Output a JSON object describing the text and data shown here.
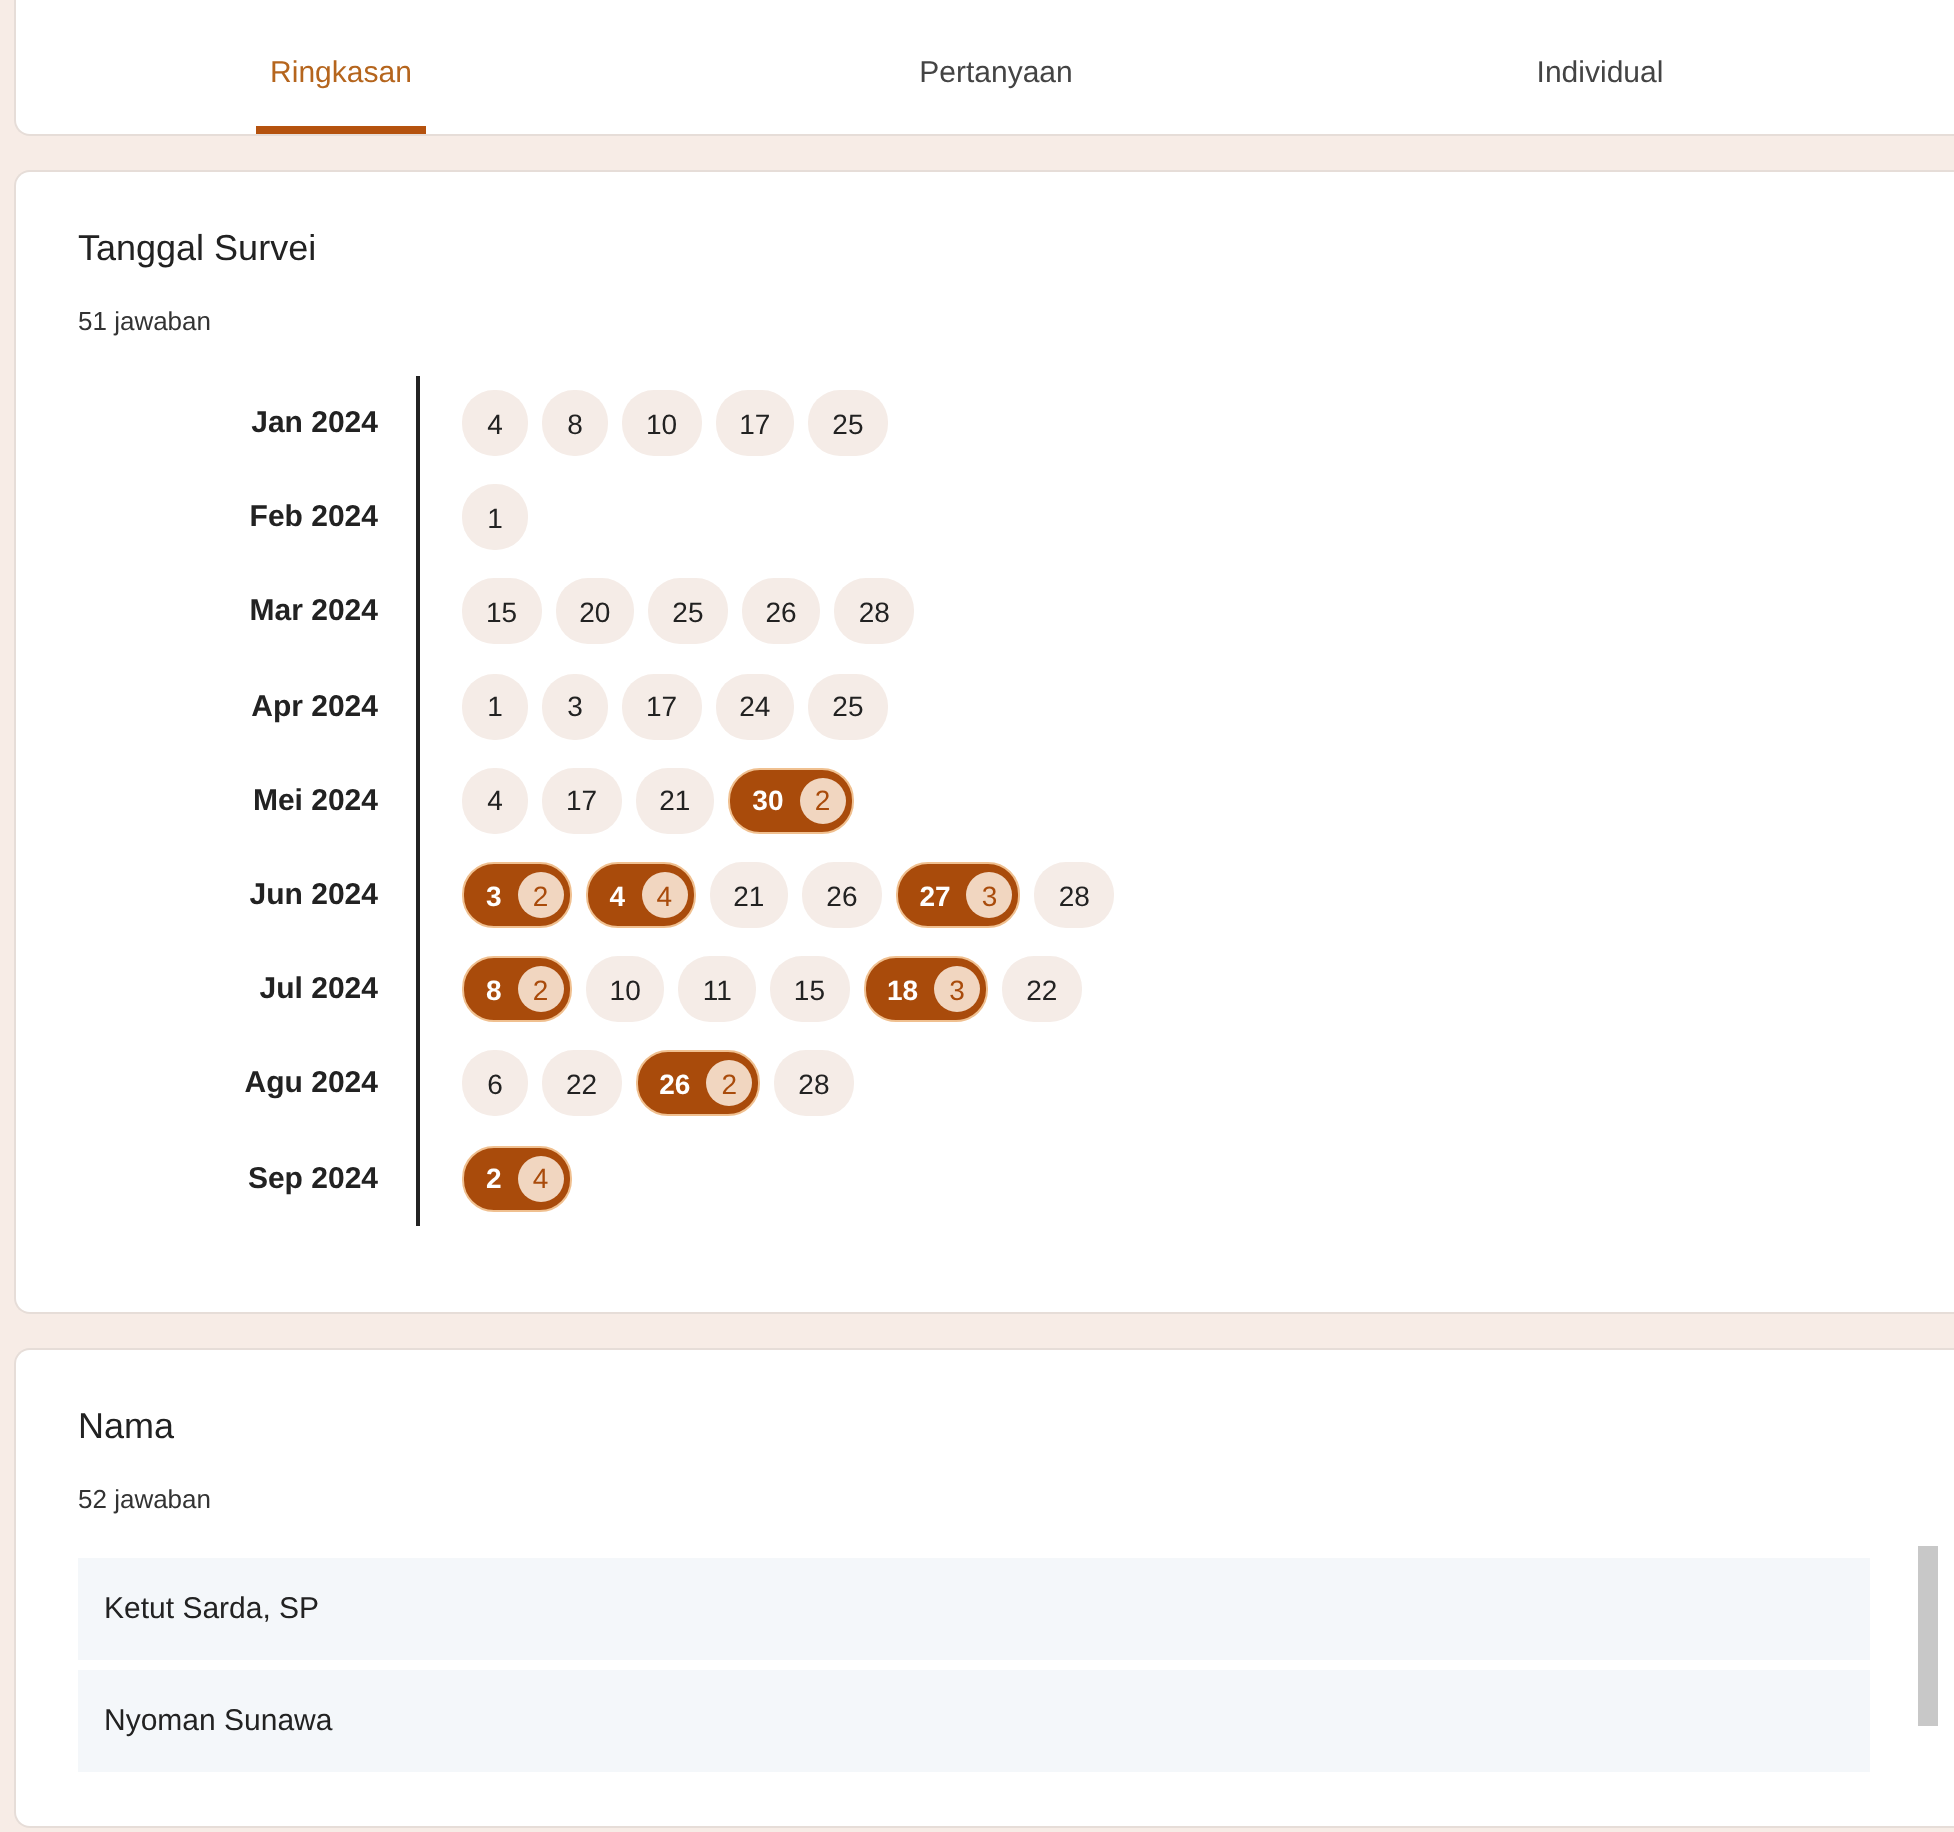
{
  "tabs": [
    {
      "label": "Ringkasan",
      "selected": true
    },
    {
      "label": "Pertanyaan",
      "selected": false
    },
    {
      "label": "Individual",
      "selected": false
    }
  ],
  "date_question": {
    "title": "Tanggal Survei",
    "responses": "51 jawaban",
    "months": [
      {
        "label": "Jan 2024",
        "days": [
          {
            "day": "4"
          },
          {
            "day": "8"
          },
          {
            "day": "10"
          },
          {
            "day": "17"
          },
          {
            "day": "25"
          }
        ]
      },
      {
        "label": "Feb 2024",
        "days": [
          {
            "day": "1"
          }
        ]
      },
      {
        "label": "Mar 2024",
        "days": [
          {
            "day": "15"
          },
          {
            "day": "20"
          },
          {
            "day": "25"
          },
          {
            "day": "26"
          },
          {
            "day": "28"
          }
        ]
      },
      {
        "label": "Apr 2024",
        "days": [
          {
            "day": "1"
          },
          {
            "day": "3"
          },
          {
            "day": "17"
          },
          {
            "day": "24"
          },
          {
            "day": "25"
          }
        ]
      },
      {
        "label": "Mei 2024",
        "days": [
          {
            "day": "4"
          },
          {
            "day": "17"
          },
          {
            "day": "21"
          },
          {
            "day": "30",
            "count": "2"
          }
        ]
      },
      {
        "label": "Jun 2024",
        "days": [
          {
            "day": "3",
            "count": "2"
          },
          {
            "day": "4",
            "count": "4"
          },
          {
            "day": "21"
          },
          {
            "day": "26"
          },
          {
            "day": "27",
            "count": "3"
          },
          {
            "day": "28"
          }
        ]
      },
      {
        "label": "Jul 2024",
        "days": [
          {
            "day": "8",
            "count": "2"
          },
          {
            "day": "10"
          },
          {
            "day": "11"
          },
          {
            "day": "15"
          },
          {
            "day": "18",
            "count": "3"
          },
          {
            "day": "22"
          }
        ]
      },
      {
        "label": "Agu 2024",
        "days": [
          {
            "day": "6"
          },
          {
            "day": "22"
          },
          {
            "day": "26",
            "count": "2"
          },
          {
            "day": "28"
          }
        ]
      },
      {
        "label": "Sep 2024",
        "days": [
          {
            "day": "2",
            "count": "4"
          }
        ]
      }
    ]
  },
  "name_question": {
    "title": "Nama",
    "responses": "52 jawaban",
    "answers": [
      "Ketut Sarda, SP",
      "Nyoman Sunawa"
    ]
  }
}
